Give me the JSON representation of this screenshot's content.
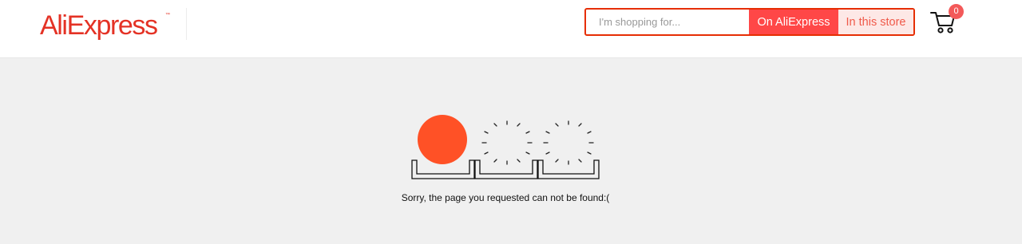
{
  "header": {
    "logo_text": "AliExpress",
    "logo_trademark": "™",
    "brand_color": "#e43225",
    "search": {
      "placeholder": "I'm shopping for...",
      "value": "",
      "button_primary": "On AliExpress",
      "button_secondary": "In this store"
    },
    "cart": {
      "icon": "cart-icon",
      "count": "0"
    }
  },
  "main": {
    "message": "Sorry, the page you requested can not be found:(",
    "illustration": {
      "ball_color": "#ff5126",
      "icons": [
        "orange-ball-icon",
        "sparkle-icon",
        "sparkle-icon",
        "tray-icon"
      ]
    }
  }
}
